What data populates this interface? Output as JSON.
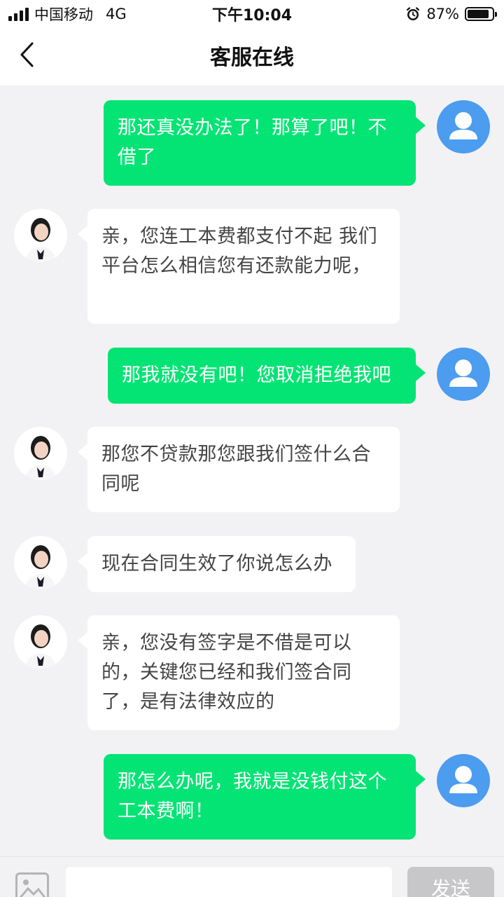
{
  "status_bar": {
    "carrier": "中国移动",
    "network": "4G",
    "time": "下午10:04",
    "battery_percent": "87%",
    "battery_level": 0.87
  },
  "nav": {
    "title": "客服在线",
    "back_icon": "chevron-left-icon"
  },
  "messages": [
    {
      "sender": "user",
      "text": "那还真没办法了！那算了吧！不借了"
    },
    {
      "sender": "agent",
      "text": "亲，您连工本费都支付不起 我们平台怎么相信您有还款能力呢，"
    },
    {
      "sender": "user",
      "text": "那我就没有吧！您取消拒绝我吧"
    },
    {
      "sender": "agent",
      "text": "那您不贷款那您跟我们签什么合同呢"
    },
    {
      "sender": "agent",
      "text": "现在合同生效了你说怎么办"
    },
    {
      "sender": "agent",
      "text": "亲，您没有签字是不借是可以的，关键您已经和我们签合同了，是有法律效应的"
    },
    {
      "sender": "user",
      "text": "那怎么办呢，我就是没钱付这个工本费啊！"
    }
  ],
  "input_bar": {
    "image_icon": "image-icon",
    "placeholder": "",
    "send_label": "发送"
  },
  "colors": {
    "outgoing_bubble": "#04e474",
    "incoming_bubble": "#ffffff",
    "user_avatar": "#4c9cf0",
    "background": "#f2f2f4",
    "send_button_disabled": "#c7c7c9"
  }
}
